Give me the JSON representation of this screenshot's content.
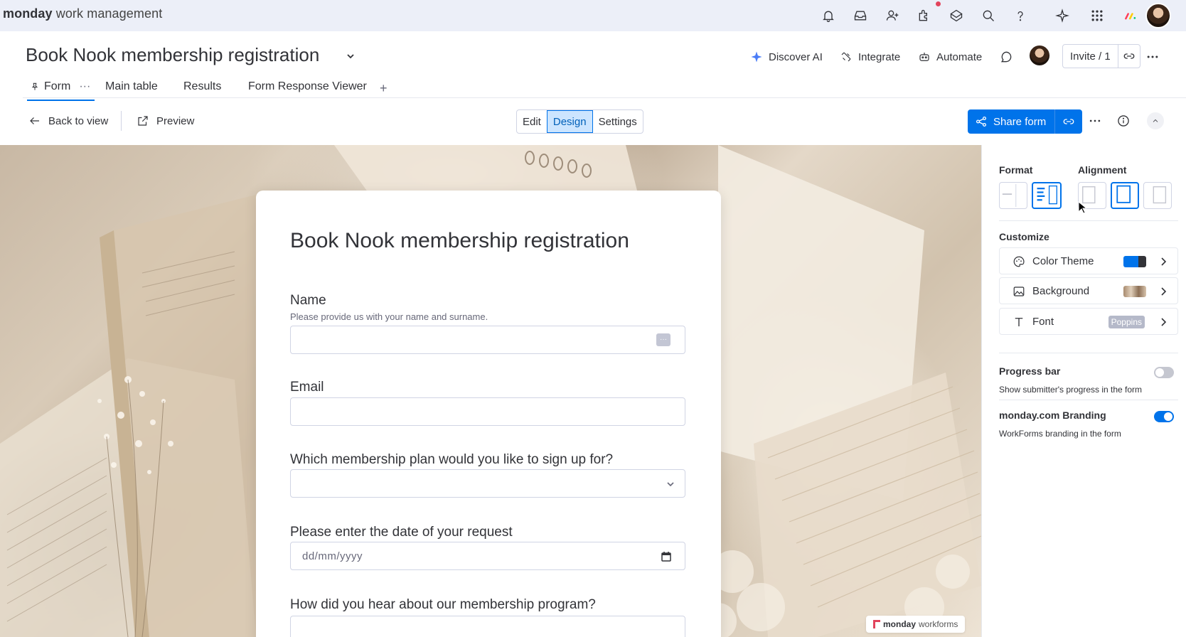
{
  "topbar": {
    "brand_bold": "monday",
    "brand_rest": " work management",
    "icons": [
      "bell-icon",
      "inbox-icon",
      "invite-members-icon",
      "apps-icon",
      "marketplace-icon",
      "search-icon",
      "help-icon",
      "ai-sparkle-icon",
      "apps-grid-icon",
      "monday-logo-icon",
      "user-avatar"
    ]
  },
  "board": {
    "title": "Book Nook membership registration",
    "actions": {
      "discover_ai": "Discover AI",
      "integrate": "Integrate",
      "automate": "Automate",
      "invite": "Invite / 1"
    },
    "tabs": [
      {
        "label": "Form",
        "active": true
      },
      {
        "label": "Main table"
      },
      {
        "label": "Results"
      },
      {
        "label": "Form Response Viewer"
      }
    ],
    "add_tab": "+",
    "tab_more": "···"
  },
  "toolbar": {
    "back": "Back to view",
    "preview": "Preview",
    "modes": [
      "Edit",
      "Design",
      "Settings"
    ],
    "active_mode": "Design",
    "share": "Share form"
  },
  "form": {
    "title": "Book Nook membership registration",
    "questions": [
      {
        "label": "Name",
        "description": "Please provide us with your name and surname.",
        "type": "text"
      },
      {
        "label": "Email",
        "type": "text"
      },
      {
        "label": "Which membership plan would you like to sign up for?",
        "type": "dropdown"
      },
      {
        "label": "Please enter the date of your request",
        "type": "date",
        "placeholder": "dd/mm/yyyy"
      },
      {
        "label": "How did you hear about our membership program?",
        "type": "text"
      }
    ],
    "dots_chip": "···",
    "branding_bold": "monday",
    "branding_rest": "workforms"
  },
  "panel": {
    "format_label": "Format",
    "alignment_label": "Alignment",
    "customize_label": "Customize",
    "rows": [
      {
        "label": "Color Theme",
        "icon": "palette-icon",
        "accent": "#0073ea"
      },
      {
        "label": "Background",
        "icon": "image-icon"
      },
      {
        "label": "Font",
        "icon": "text-icon",
        "value": "Poppins"
      }
    ],
    "progress_bar": {
      "title": "Progress bar",
      "description": "Show submitter's progress in the form",
      "enabled": false
    },
    "branding": {
      "title": "monday.com Branding",
      "description": "WorkForms branding in the form",
      "enabled": true
    }
  }
}
